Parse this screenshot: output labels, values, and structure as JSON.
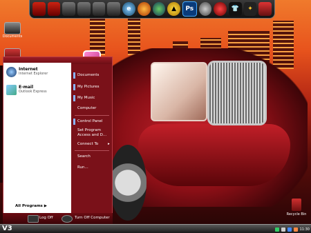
{
  "desktop": {
    "icons": [
      {
        "label": "Documents"
      },
      {
        "label": ""
      }
    ],
    "recycle_bin": {
      "label": "Recycle Bin"
    }
  },
  "dock": {
    "icons": [
      "screen-icon",
      "screen-icon",
      "folder-icon",
      "folder-icon",
      "folder-icon",
      "folder-icon",
      "ie-icon",
      "firefox-icon",
      "network-icon",
      "warning-icon",
      "photoshop-icon",
      "paint-icon",
      "record-icon",
      "shirt-icon",
      "tool-icon",
      "trash-icon"
    ],
    "photoshop_label": "Ps"
  },
  "start_menu": {
    "pinned": [
      {
        "title": "Internet",
        "subtitle": "Internet Explorer"
      },
      {
        "title": "E-mail",
        "subtitle": "Outlook Express"
      }
    ],
    "all_programs": "All Programs",
    "right": {
      "documents": "Documents",
      "my_pictures": "My Pictures",
      "my_music": "My Music",
      "computer": "Computer",
      "control_panel": "Control Panel",
      "set_program_access": "Set Program Access and D...",
      "connect_to": "Connect To",
      "search": "Search",
      "run": "Run..."
    },
    "log_off": "Log Off",
    "turn_off": "Turn Off Computer"
  },
  "taskbar": {
    "start_label": "V3",
    "clock": "11:30"
  },
  "colors": {
    "menu": "#7a1119",
    "accent": "#c9232d"
  }
}
